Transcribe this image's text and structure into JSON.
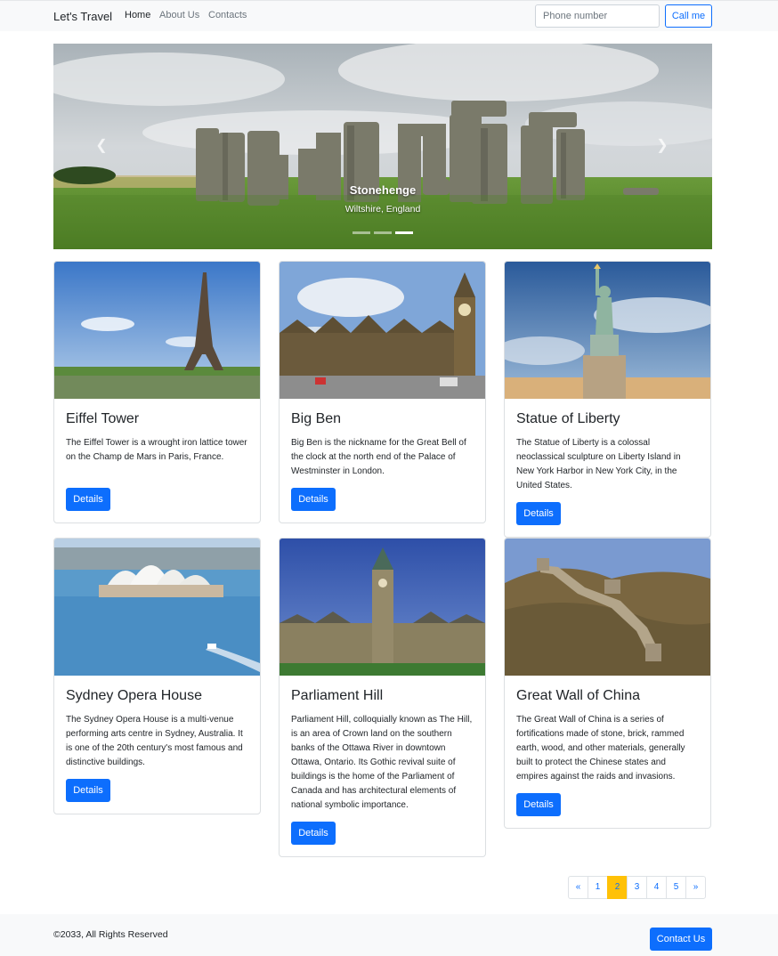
{
  "navbar": {
    "brand": "Let's Travel",
    "links": [
      {
        "label": "Home",
        "active": true
      },
      {
        "label": "About Us",
        "active": false
      },
      {
        "label": "Contacts",
        "active": false
      }
    ],
    "phone_placeholder": "Phone number",
    "call_label": "Call me"
  },
  "carousel": {
    "title": "Stonehenge",
    "subtitle": "Wiltshire, England",
    "prev_icon": "chevron-left-icon",
    "next_icon": "chevron-right-icon",
    "slide_count": 3,
    "active_slide": 3
  },
  "cards": [
    {
      "title": "Eiffel Tower",
      "text": "The Eiffel Tower is a wrought iron lattice tower on the Champ de Mars in Paris, France.",
      "button": "Details"
    },
    {
      "title": "Big Ben",
      "text": "Big Ben is the nickname for the Great Bell of the clock at the north end of the Palace of Westminster in London.",
      "button": "Details"
    },
    {
      "title": "Statue of Liberty",
      "text": "The Statue of Liberty is a colossal neoclassical sculpture on Liberty Island in New York Harbor in New York City, in the United States.",
      "button": "Details"
    },
    {
      "title": "Sydney Opera House",
      "text": "The Sydney Opera House is a multi-venue performing arts centre in Sydney, Australia. It is one of the 20th century's most famous and distinctive buildings.",
      "button": "Details"
    },
    {
      "title": "Parliament Hill",
      "text": "Parliament Hill, colloquially known as The Hill, is an area of Crown land on the southern banks of the Ottawa River in downtown Ottawa, Ontario. Its Gothic revival suite of buildings is the home of the Parliament of Canada and has architectural elements of national symbolic importance.",
      "button": "Details"
    },
    {
      "title": "Great Wall of China",
      "text": "The Great Wall of China is a series of fortifications made of stone, brick, rammed earth, wood, and other materials, generally built to protect the Chinese states and empires against the raids and invasions.",
      "button": "Details"
    }
  ],
  "pagination": {
    "prev": "«",
    "pages": [
      "1",
      "2",
      "3",
      "4",
      "5"
    ],
    "active_page": "2",
    "next": "»"
  },
  "footer": {
    "copyright": "©2033, All Rights Reserved",
    "contact_label": "Contact Us"
  },
  "colors": {
    "primary": "#0d6efd",
    "active_page": "#ffc107",
    "navbar_bg": "#f8f9fa"
  }
}
